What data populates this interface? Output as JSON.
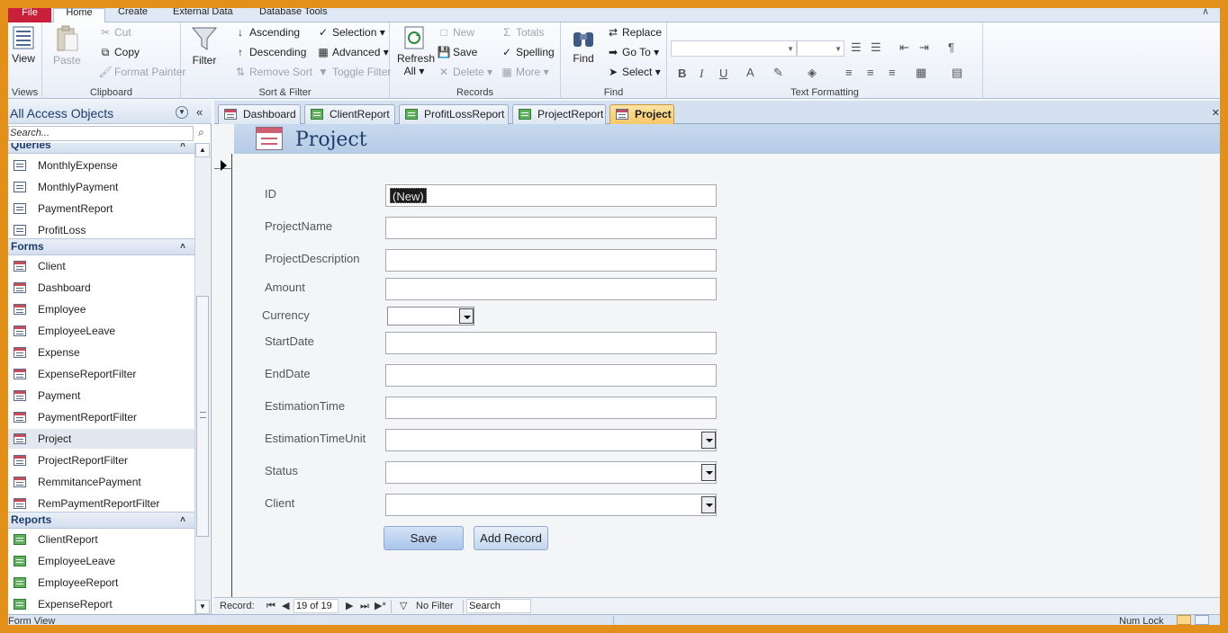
{
  "ribbon_tabs": {
    "file": "File",
    "home": "Home",
    "create": "Create",
    "external_data": "External Data",
    "database_tools": "Database Tools"
  },
  "ribbon": {
    "views": {
      "view_label": "View",
      "group_label": "Views"
    },
    "clipboard": {
      "paste": "Paste",
      "cut": "Cut",
      "copy": "Copy",
      "format_painter": "Format Painter",
      "group_label": "Clipboard"
    },
    "sort_filter": {
      "filter": "Filter",
      "ascending": "Ascending",
      "descending": "Descending",
      "remove_sort": "Remove Sort",
      "selection": "Selection",
      "advanced": "Advanced",
      "toggle_filter": "Toggle Filter",
      "group_label": "Sort & Filter"
    },
    "records": {
      "refresh_all": "Refresh",
      "refresh_all_2": "All",
      "new": "New",
      "save": "Save",
      "delete": "Delete",
      "totals": "Totals",
      "spelling": "Spelling",
      "more": "More",
      "group_label": "Records"
    },
    "find": {
      "find": "Find",
      "replace": "Replace",
      "go_to": "Go To",
      "select": "Select",
      "group_label": "Find"
    },
    "text_formatting": {
      "bold": "B",
      "italic": "I",
      "underline": "U",
      "group_label": "Text Formatting"
    }
  },
  "nav": {
    "title": "All Access Objects",
    "search_placeholder": "Search...",
    "sections": {
      "queries": "Queries",
      "forms": "Forms",
      "reports": "Reports"
    },
    "queries": [
      "MonthlyExpense",
      "MonthlyPayment",
      "PaymentReport",
      "ProfitLoss"
    ],
    "forms": [
      "Client",
      "Dashboard",
      "Employee",
      "EmployeeLeave",
      "Expense",
      "ExpenseReportFilter",
      "Payment",
      "PaymentReportFilter",
      "Project",
      "ProjectReportFilter",
      "RemmitancePayment",
      "RemPaymentReportFilter"
    ],
    "reports": [
      "ClientReport",
      "EmployeeLeave",
      "EmployeeReport",
      "ExpenseReport"
    ],
    "selected": "Project"
  },
  "doc_tabs": [
    "Dashboard",
    "ClientReport",
    "ProfitLossReport",
    "ProjectReport",
    "Project"
  ],
  "form": {
    "title": "Project",
    "fields": {
      "id_label": "ID",
      "id_value": "(New)",
      "project_name_label": "ProjectName",
      "project_description_label": "ProjectDescription",
      "amount_label": "Amount",
      "currency_label": "Currency",
      "start_date_label": "StartDate",
      "end_date_label": "EndDate",
      "estimation_time_label": "EstimationTime",
      "estimation_time_unit_label": "EstimationTimeUnit",
      "status_label": "Status",
      "client_label": "Client"
    },
    "buttons": {
      "save": "Save",
      "add_record": "Add Record"
    }
  },
  "record_nav": {
    "label": "Record:",
    "position": "19 of 19",
    "filter": "No Filter",
    "search": "Search"
  },
  "status_bar": {
    "left": "Form View",
    "right": "Num Lock"
  },
  "colors": {
    "frame": "#e3901a",
    "file_tab": "#c8203b",
    "active_doc_tab": "#f6c866",
    "form_header": "#b6cbe6"
  }
}
